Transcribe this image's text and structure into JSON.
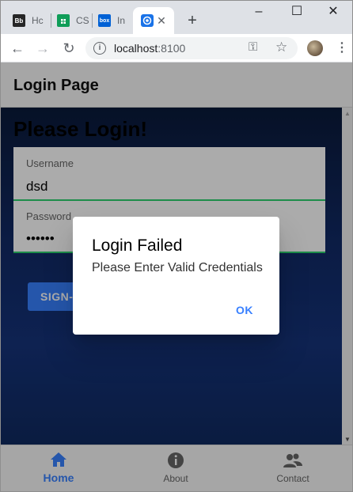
{
  "browser": {
    "tabs": [
      {
        "favicon": "Bb",
        "title": "Hc",
        "color": "#262626"
      },
      {
        "favicon": "sheets-icon",
        "title": "CS",
        "color": "#0f9d58"
      },
      {
        "favicon": "box",
        "title": "In",
        "color": "#0061d5"
      },
      {
        "favicon": "chromium-icon",
        "title": "",
        "color": "#1a73e8"
      }
    ],
    "address": {
      "host": "localhost",
      "port": ":8100"
    }
  },
  "app": {
    "header_title": "Login Page",
    "greeting": "Please Login!",
    "form": {
      "username_label": "Username",
      "username_value": "dsd",
      "password_label": "Password",
      "password_value": "••••••"
    },
    "signin_label": "SIGN-IN",
    "tabbar": [
      {
        "label": "Home",
        "icon": "home-icon",
        "selected": true
      },
      {
        "label": "About",
        "icon": "info-icon",
        "selected": false
      },
      {
        "label": "Contact",
        "icon": "people-icon",
        "selected": false
      }
    ]
  },
  "dialog": {
    "title": "Login Failed",
    "message": "Please Enter Valid Credentials",
    "ok_label": "OK"
  },
  "colors": {
    "primary": "#3880ff",
    "success_line": "#2dd36f"
  }
}
